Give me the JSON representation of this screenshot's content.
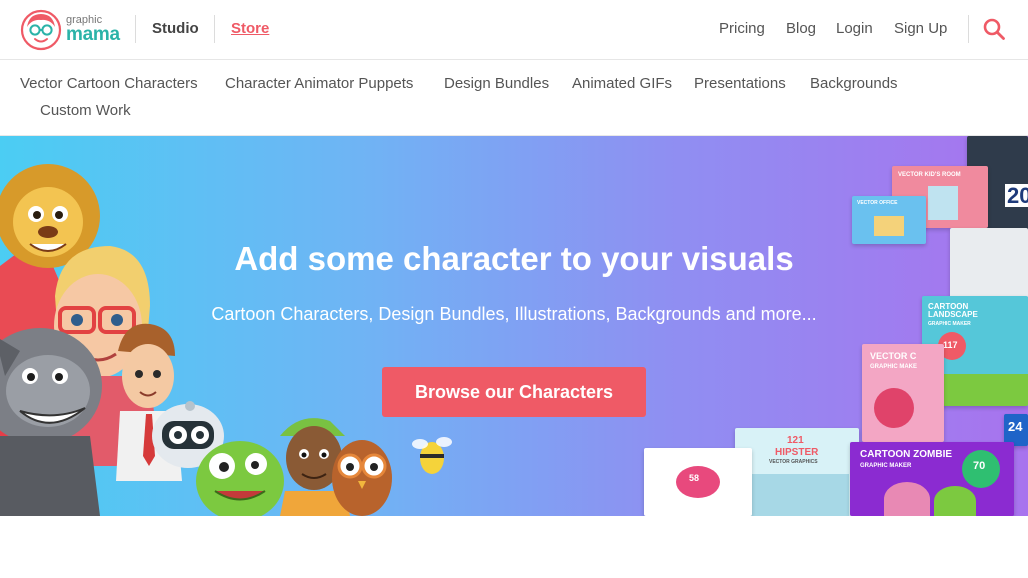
{
  "brand": {
    "logo_top": "graphic",
    "logo_main": "mama"
  },
  "header": {
    "studio_label": "Studio",
    "store_label": "Store",
    "right_links": [
      "Pricing",
      "Blog",
      "Login",
      "Sign Up"
    ]
  },
  "categories": [
    "Vector Cartoon Characters",
    "Character Animator Puppets",
    "Design Bundles",
    "Animated GIFs",
    "Presentations",
    "Backgrounds",
    "Custom Work"
  ],
  "hero": {
    "title": "Add some character to your visuals",
    "subtitle": "Cartoon Characters, Design Bundles, Illustrations, Backgrounds and more...",
    "cta_label": "Browse our Characters"
  },
  "product_cards": {
    "kids_room": "VECTOR KID'S ROOM",
    "office": "VECTOR OFFICE",
    "landscape": "CARTOON LANDSCAPE",
    "landscape_sub": "GRAPHIC MAKER",
    "landscape_badge": "117",
    "vector_c": "VECTOR C",
    "vector_c_sub": "GRAPHIC MAKE",
    "hipster_num": "121",
    "hipster_title": "HIPSTER",
    "hipster_sub": "VECTOR GRAPHICS",
    "zombie_title": "CARTOON ZOMBIE",
    "zombie_sub": "GRAPHIC MAKER",
    "zombie_badge": "70",
    "edge_top": "20",
    "edge_bottom": "24",
    "sale": "58"
  },
  "colors": {
    "accent": "#ef5a66",
    "brand_teal": "#2bb3a8",
    "hero_start": "#4bcdf3",
    "hero_end": "#a873ee"
  },
  "icons": {
    "search": "search-icon",
    "logo": "glasses-lady-logo-icon"
  }
}
